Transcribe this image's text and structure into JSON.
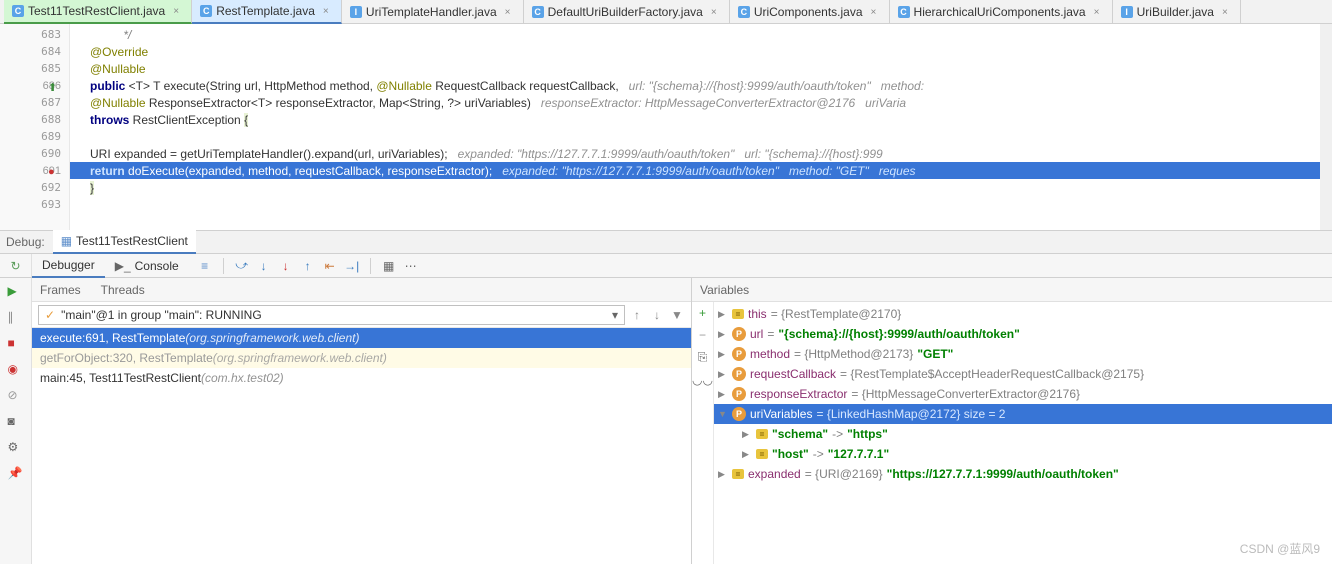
{
  "tabs": [
    {
      "icon": "C",
      "label": "Test11TestRestClient.java",
      "activeClass": "active-green"
    },
    {
      "icon": "C",
      "label": "RestTemplate.java",
      "activeClass": "active-blue"
    },
    {
      "icon": "I",
      "label": "UriTemplateHandler.java",
      "activeClass": ""
    },
    {
      "icon": "C",
      "label": "DefaultUriBuilderFactory.java",
      "activeClass": ""
    },
    {
      "icon": "C",
      "label": "UriComponents.java",
      "activeClass": ""
    },
    {
      "icon": "C",
      "label": "HierarchicalUriComponents.java",
      "activeClass": ""
    },
    {
      "icon": "I",
      "label": "UriBuilder.java",
      "activeClass": ""
    }
  ],
  "gutter": [
    "683",
    "684",
    "685",
    "686",
    "687",
    "688",
    "689",
    "690",
    "691",
    "692",
    "693"
  ],
  "code": {
    "l683": "          */",
    "l684_ann": "@Override",
    "l685_ann": "@Nullable",
    "l686_a": "public ",
    "l686_b": "<T> T execute(String url, HttpMethod method, ",
    "l686_c": "@Nullable",
    "l686_d": " RequestCallback requestCallback,   ",
    "l686_hint": "url: \"{schema}://{host}:9999/auth/oauth/token\"   method:",
    "l687_a": "@Nullable",
    "l687_b": " ResponseExtractor<T> responseExtractor, Map<String, ?> uriVariables)   ",
    "l687_hint": "responseExtractor: HttpMessageConverterExtractor@2176   uriVaria",
    "l688_a": "throws ",
    "l688_b": "RestClientException ",
    "l688_brace": "{",
    "l690_a": "URI expanded = getUriTemplateHandler().expand(url, uriVariables);   ",
    "l690_hint": "expanded: \"https://127.7.7.1:9999/auth/oauth/token\"   url: \"{schema}://{host}:999",
    "l691_a": "return ",
    "l691_b": "doExecute(expanded, method, requestCallback, responseExtractor);   ",
    "l691_hint": "expanded: \"https://127.7.7.1:9999/auth/oauth/token\"   method: \"GET\"   reques",
    "l692_brace": "}"
  },
  "debug": {
    "label": "Debug:",
    "config": "Test11TestRestClient",
    "debuggerTab": "Debugger",
    "consoleTab": "Console",
    "framesTab": "Frames",
    "threadsTab": "Threads",
    "variablesTab": "Variables",
    "threadCombo": "\"main\"@1 in group \"main\": RUNNING",
    "frames": [
      {
        "text": "execute:691, RestTemplate ",
        "pkg": "(org.springframework.web.client)",
        "cls": "selected"
      },
      {
        "text": "getForObject:320, RestTemplate ",
        "pkg": "(org.springframework.web.client)",
        "cls": "muted"
      },
      {
        "text": "main:45, Test11TestRestClient ",
        "pkg": "(com.hx.test02)",
        "cls": "normal"
      }
    ],
    "vars": [
      {
        "indent": 0,
        "arrow": "▶",
        "icon": "eq",
        "name": "this",
        "rest": " = {RestTemplate@2170}",
        "cls": ""
      },
      {
        "indent": 0,
        "arrow": "▶",
        "icon": "p",
        "name": "url",
        "rest": " = ",
        "str": "\"{schema}://{host}:9999/auth/oauth/token\"",
        "cls": ""
      },
      {
        "indent": 0,
        "arrow": "▶",
        "icon": "p",
        "name": "method",
        "rest": " = {HttpMethod@2173} ",
        "str": "\"GET\"",
        "cls": ""
      },
      {
        "indent": 0,
        "arrow": "▶",
        "icon": "p",
        "name": "requestCallback",
        "rest": " = {RestTemplate$AcceptHeaderRequestCallback@2175}",
        "cls": ""
      },
      {
        "indent": 0,
        "arrow": "▶",
        "icon": "p",
        "name": "responseExtractor",
        "rest": " = {HttpMessageConverterExtractor@2176}",
        "cls": ""
      },
      {
        "indent": 0,
        "arrow": "▼",
        "icon": "p",
        "name": "uriVariables",
        "rest": " = {LinkedHashMap@2172}  size = 2",
        "cls": "selected"
      },
      {
        "indent": 1,
        "arrow": "▶",
        "icon": "eq",
        "name": "",
        "str": "\"schema\"",
        "mid": " -> ",
        "str2": "\"https\"",
        "cls": ""
      },
      {
        "indent": 1,
        "arrow": "▶",
        "icon": "eq",
        "name": "",
        "str": "\"host\"",
        "mid": " -> ",
        "str2": "\"127.7.7.1\"",
        "cls": ""
      },
      {
        "indent": 0,
        "arrow": "▶",
        "icon": "eq",
        "name": "expanded",
        "rest": " = {URI@2169} ",
        "str": "\"https://127.7.7.1:9999/auth/oauth/token\"",
        "cls": ""
      }
    ]
  },
  "watermark": "CSDN @蓝风9"
}
